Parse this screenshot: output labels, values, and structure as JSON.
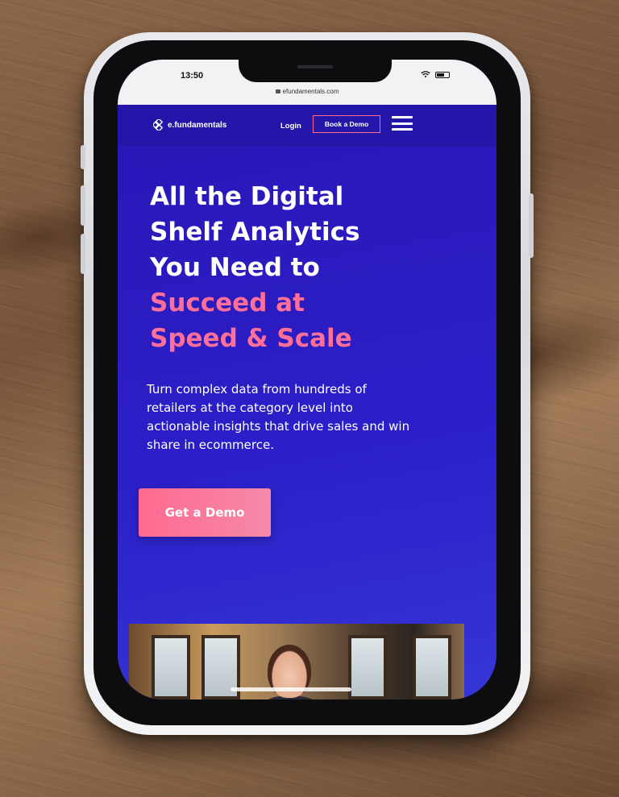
{
  "status_bar": {
    "time": "13:50",
    "url": "efundamentals.com"
  },
  "header": {
    "logo_text": "e.fundamentals",
    "login_label": "Login",
    "book_demo_label": "Book a Demo"
  },
  "hero": {
    "title_line1": "All the Digital",
    "title_line2": "Shelf Analytics",
    "title_line3": "You Need to",
    "title_accent_line1": "Succeed at",
    "title_accent_line2": "Speed & Scale",
    "description": "Turn complex data from hundreds of retailers at the category level into actionable insights that drive sales and win share in ecommerce.",
    "cta_label": "Get a Demo"
  },
  "colors": {
    "hero_background": "#2c1fc9",
    "accent_pink": "#ff6f98",
    "header_background": "#2316a8"
  },
  "icons": {
    "menu": "hamburger-menu-icon",
    "wifi": "wifi-icon",
    "battery": "battery-icon",
    "lock": "lock-icon",
    "logo": "efundamentals-logo-mark"
  }
}
